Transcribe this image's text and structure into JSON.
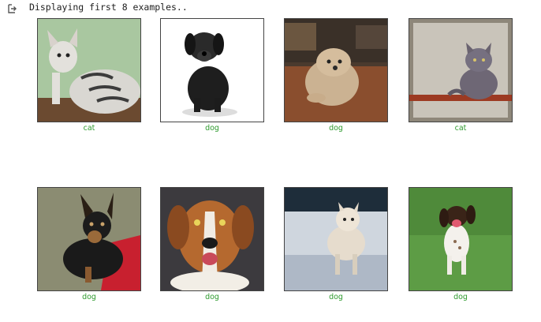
{
  "output": {
    "icon": "output-arrow-icon",
    "text": "Displaying first 8 examples.."
  },
  "colors": {
    "caption": "#2e9a2e",
    "border": "#444444"
  },
  "examples": [
    {
      "label": "cat",
      "icon": "cat-icon"
    },
    {
      "label": "dog",
      "icon": "dog-icon"
    },
    {
      "label": "dog",
      "icon": "dog-icon"
    },
    {
      "label": "cat",
      "icon": "cat-icon"
    },
    {
      "label": "dog",
      "icon": "dog-icon"
    },
    {
      "label": "dog",
      "icon": "dog-icon"
    },
    {
      "label": "dog",
      "icon": "dog-icon"
    },
    {
      "label": "dog",
      "icon": "dog-icon"
    }
  ]
}
